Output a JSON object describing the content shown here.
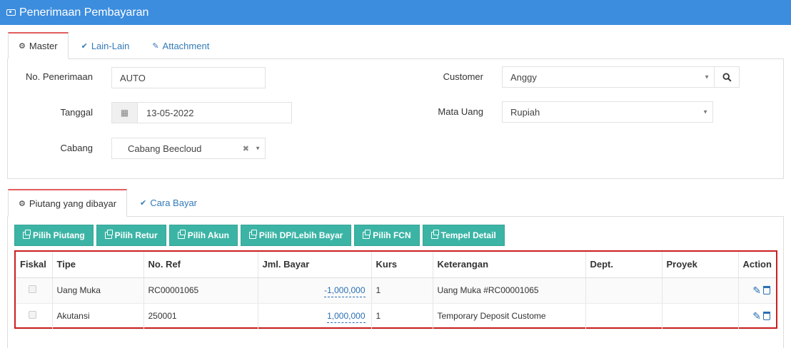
{
  "window": {
    "title": "Penerimaan Pembayaran"
  },
  "top_tabs": [
    {
      "label": "Master",
      "icon": "gears-icon",
      "active": true
    },
    {
      "label": "Lain-Lain",
      "icon": "check-circle-icon",
      "active": false
    },
    {
      "label": "Attachment",
      "icon": "paperclip-icon",
      "active": false
    }
  ],
  "form": {
    "no_penerimaan": {
      "label": "No. Penerimaan",
      "value": "AUTO"
    },
    "tanggal": {
      "label": "Tanggal",
      "value": "13-05-2022"
    },
    "cabang": {
      "label": "Cabang",
      "value": "Cabang Beecloud"
    },
    "customer": {
      "label": "Customer",
      "value": "Anggy"
    },
    "mata_uang": {
      "label": "Mata Uang",
      "value": "Rupiah"
    }
  },
  "detail_tabs": [
    {
      "label": "Piutang yang dibayar",
      "icon": "gears-icon",
      "active": true
    },
    {
      "label": "Cara Bayar",
      "icon": "check-circle-icon",
      "active": false
    }
  ],
  "buttons": {
    "pilih_piutang": "Pilih Piutang",
    "pilih_retur": "Pilih Retur",
    "pilih_akun": "Pilih Akun",
    "pilih_dp": "Pilih DP/Lebih Bayar",
    "pilih_fcn": "Pilih FCN",
    "tempel_detail": "Tempel Detail"
  },
  "table": {
    "columns": [
      "Fiskal",
      "Tipe",
      "No. Ref",
      "Jml. Bayar",
      "Kurs",
      "Keterangan",
      "Dept.",
      "Proyek",
      "Action"
    ],
    "rows": [
      {
        "tipe": "Uang Muka",
        "no_ref": "RC00001065",
        "jml_bayar": "-1,000,000",
        "kurs": "1",
        "keterangan": "Uang Muka #RC00001065",
        "dept": "",
        "proyek": ""
      },
      {
        "tipe": "Akutansi",
        "no_ref": "250001",
        "jml_bayar": "1,000,000",
        "kurs": "1",
        "keterangan": "Temporary Deposit Custome",
        "dept": "",
        "proyek": ""
      }
    ]
  },
  "colors": {
    "titlebar": "#3c8dde",
    "button": "#3cb4a5",
    "highlight_border": "#cc1f1f",
    "tab_active_top": "#e35d5d",
    "link": "#337ab7"
  }
}
